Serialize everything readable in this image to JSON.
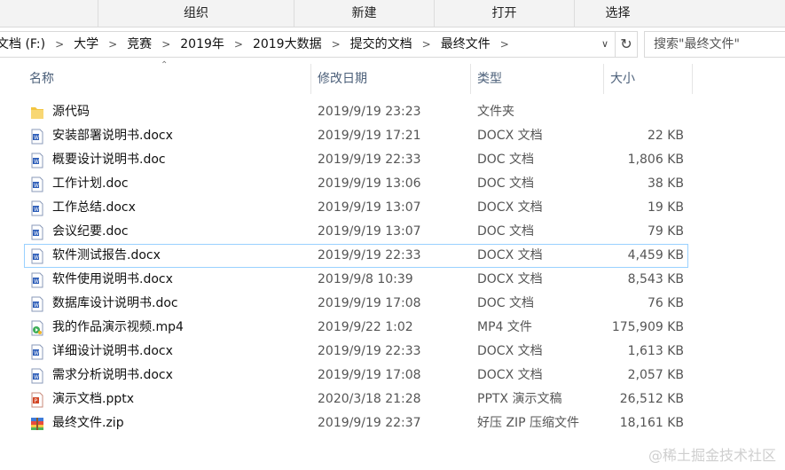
{
  "ribbon": {
    "groups": [
      "组织",
      "新建",
      "打开",
      "选择"
    ]
  },
  "address": {
    "crumbs": [
      "文档 (F:)",
      "大学",
      "竞赛",
      "2019年",
      "2019大数据",
      "提交的文档",
      "最终文件"
    ]
  },
  "search": {
    "placeholder": "搜索\"最终文件\""
  },
  "header": {
    "name": "名称",
    "date": "修改日期",
    "type": "类型",
    "size": "大小"
  },
  "files": [
    {
      "name": "源代码",
      "date": "2019/9/19 23:23",
      "type": "文件夹",
      "size": "",
      "icon": "folder-icon"
    },
    {
      "name": "安装部署说明书.docx",
      "date": "2019/9/19 17:21",
      "type": "DOCX 文档",
      "size": "22 KB",
      "icon": "word-doc-icon"
    },
    {
      "name": "概要设计说明书.doc",
      "date": "2019/9/19 22:33",
      "type": "DOC 文档",
      "size": "1,806 KB",
      "icon": "word-doc-icon"
    },
    {
      "name": "工作计划.doc",
      "date": "2019/9/19 13:06",
      "type": "DOC 文档",
      "size": "38 KB",
      "icon": "word-doc-icon"
    },
    {
      "name": "工作总结.docx",
      "date": "2019/9/19 13:07",
      "type": "DOCX 文档",
      "size": "19 KB",
      "icon": "word-doc-icon"
    },
    {
      "name": "会议纪要.doc",
      "date": "2019/9/19 13:07",
      "type": "DOC 文档",
      "size": "79 KB",
      "icon": "word-doc-icon"
    },
    {
      "name": "软件测试报告.docx",
      "date": "2019/9/19 22:33",
      "type": "DOCX 文档",
      "size": "4,459 KB",
      "icon": "word-doc-icon"
    },
    {
      "name": "软件使用说明书.docx",
      "date": "2019/9/8 10:39",
      "type": "DOCX 文档",
      "size": "8,543 KB",
      "icon": "word-doc-icon"
    },
    {
      "name": "数据库设计说明书.doc",
      "date": "2019/9/19 17:08",
      "type": "DOC 文档",
      "size": "76 KB",
      "icon": "word-doc-icon"
    },
    {
      "name": "我的作品演示视频.mp4",
      "date": "2019/9/22 1:02",
      "type": "MP4 文件",
      "size": "175,909 KB",
      "icon": "video-file-icon"
    },
    {
      "name": "详细设计说明书.docx",
      "date": "2019/9/19 22:33",
      "type": "DOCX 文档",
      "size": "1,613 KB",
      "icon": "word-doc-icon"
    },
    {
      "name": "需求分析说明书.docx",
      "date": "2019/9/19 17:08",
      "type": "DOCX 文档",
      "size": "2,057 KB",
      "icon": "word-doc-icon"
    },
    {
      "name": "演示文档.pptx",
      "date": "2020/3/18 21:28",
      "type": "PPTX 演示文稿",
      "size": "26,512 KB",
      "icon": "powerpoint-file-icon"
    },
    {
      "name": "最终文件.zip",
      "date": "2019/9/19 22:37",
      "type": "好压 ZIP 压缩文件",
      "size": "18,161 KB",
      "icon": "zip-archive-icon"
    }
  ],
  "selected_index": 6,
  "watermark": "@稀土掘金技术社区",
  "colors": {
    "header_text": "#4c607a",
    "selection_border": "#99d1ff",
    "word_blue": "#2b5cb8",
    "ppt_orange": "#d24726",
    "folder_yellow": "#f3c541"
  }
}
